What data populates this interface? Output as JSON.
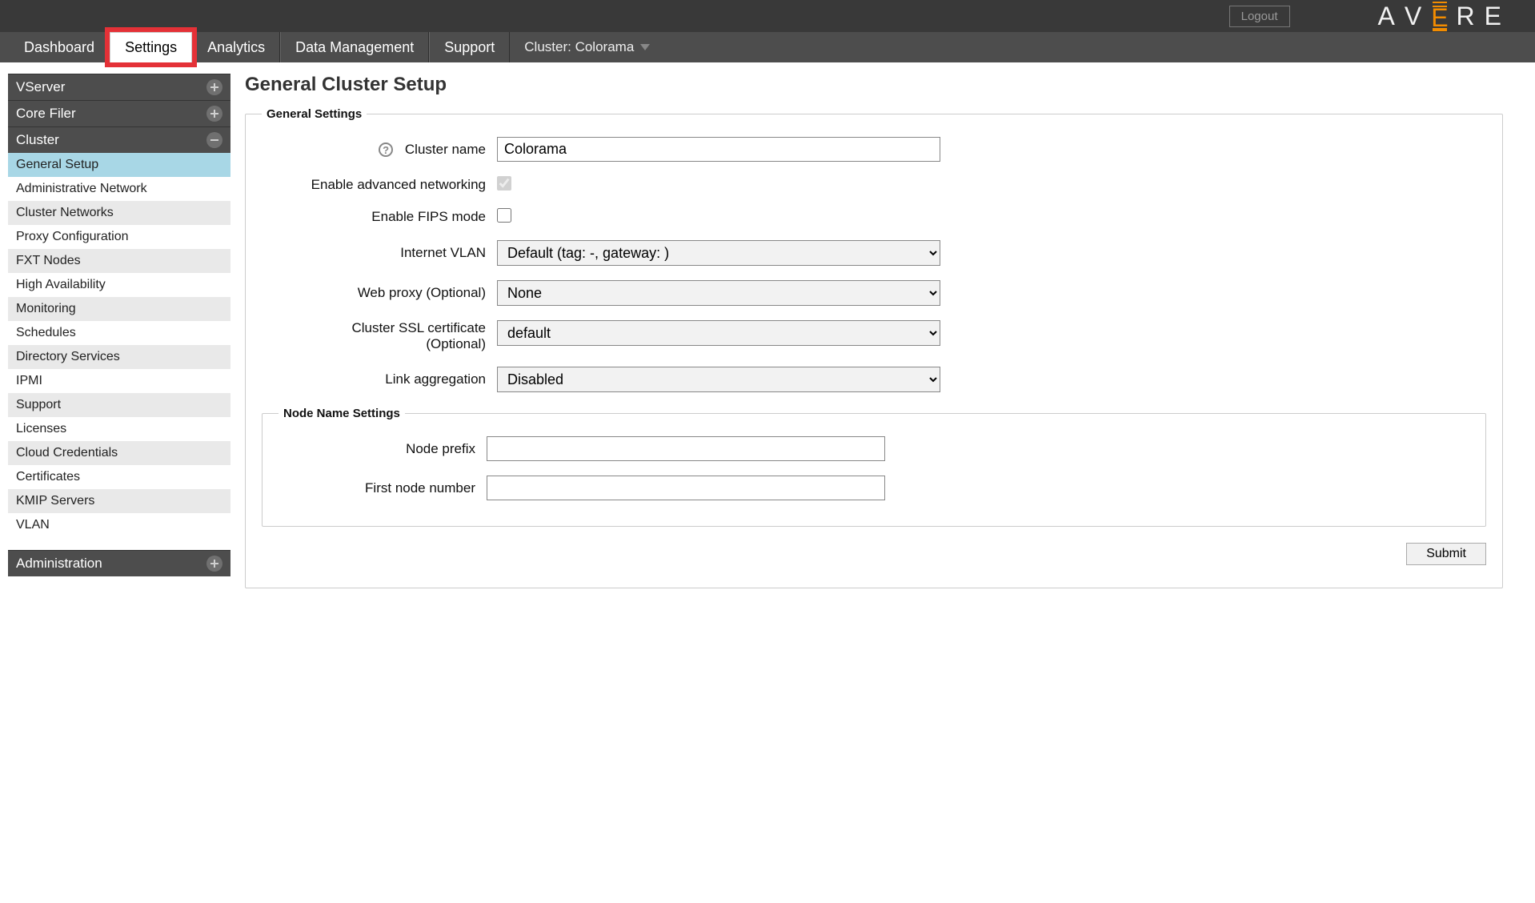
{
  "header": {
    "logout": "Logout",
    "brand_letters": [
      "A",
      "V",
      "R",
      "E"
    ]
  },
  "nav": {
    "tabs": [
      {
        "label": "Dashboard"
      },
      {
        "label": "Settings",
        "active": true,
        "highlighted": true
      },
      {
        "label": "Analytics"
      },
      {
        "label": "Data Management"
      },
      {
        "label": "Support"
      }
    ],
    "cluster_label": "Cluster: Colorama"
  },
  "sidebar": {
    "sections": [
      {
        "title": "VServer",
        "icon": "plus",
        "items": []
      },
      {
        "title": "Core Filer",
        "icon": "plus",
        "items": []
      },
      {
        "title": "Cluster",
        "icon": "minus",
        "items": [
          "General Setup",
          "Administrative Network",
          "Cluster Networks",
          "Proxy Configuration",
          "FXT Nodes",
          "High Availability",
          "Monitoring",
          "Schedules",
          "Directory Services",
          "IPMI",
          "Support",
          "Licenses",
          "Cloud Credentials",
          "Certificates",
          "KMIP Servers",
          "VLAN"
        ],
        "selected_item": "General Setup"
      },
      {
        "title": "Administration",
        "icon": "plus",
        "items": []
      }
    ]
  },
  "main": {
    "title": "General Cluster Setup",
    "general_legend": "General Settings",
    "fields": {
      "cluster_name_label": "Cluster name",
      "cluster_name_value": "Colorama",
      "adv_net_label": "Enable advanced networking",
      "adv_net_checked": true,
      "fips_label": "Enable FIPS mode",
      "fips_checked": false,
      "ivlan_label": "Internet VLAN",
      "ivlan_value": "Default (tag: -, gateway:                )",
      "webproxy_label": "Web proxy (Optional)",
      "webproxy_value": "None",
      "sslcert_label_line1": "Cluster SSL certificate",
      "sslcert_label_line2": "(Optional)",
      "sslcert_value": "default",
      "linkagg_label": "Link aggregation",
      "linkagg_value": "Disabled"
    },
    "node_legend": "Node Name Settings",
    "node_fields": {
      "prefix_label": "Node prefix",
      "prefix_value": "",
      "firstnum_label": "First node number",
      "firstnum_value": ""
    },
    "submit_label": "Submit"
  }
}
